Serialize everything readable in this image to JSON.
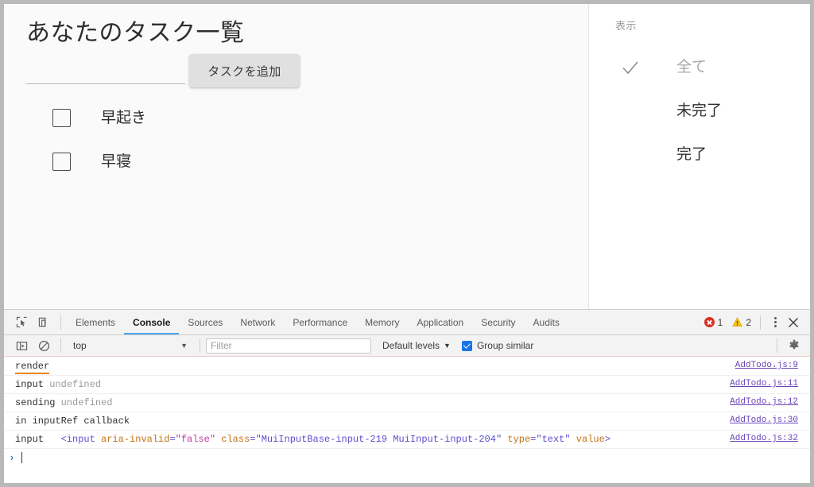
{
  "page": {
    "title": "あなたのタスク一覧",
    "input": {
      "value": "",
      "placeholder": ""
    },
    "add_button_label": "タスクを追加",
    "todos": [
      {
        "label": "早起き",
        "checked": false
      },
      {
        "label": "早寝",
        "checked": false
      }
    ],
    "filter_panel": {
      "heading": "表示",
      "items": [
        {
          "label": "全て",
          "selected": true
        },
        {
          "label": "未完了",
          "selected": false
        },
        {
          "label": "完了",
          "selected": false
        }
      ]
    }
  },
  "devtools": {
    "tabs": [
      {
        "label": "Elements",
        "active": false
      },
      {
        "label": "Console",
        "active": true
      },
      {
        "label": "Sources",
        "active": false
      },
      {
        "label": "Network",
        "active": false
      },
      {
        "label": "Performance",
        "active": false
      },
      {
        "label": "Memory",
        "active": false
      },
      {
        "label": "Application",
        "active": false
      },
      {
        "label": "Security",
        "active": false
      },
      {
        "label": "Audits",
        "active": false
      }
    ],
    "error_count": "1",
    "warning_count": "2",
    "filterbar": {
      "context": "top",
      "context_caret": "▼",
      "filter_placeholder": "Filter",
      "filter_value": "",
      "levels_label": "Default levels",
      "levels_caret": "▼",
      "group_similar_label": "Group similar",
      "group_similar_checked": true
    },
    "console_messages": [
      {
        "parts": [
          {
            "text": "render",
            "style": "plain-underline"
          }
        ],
        "source": "AddTodo.js:9"
      },
      {
        "parts": [
          {
            "text": "input ",
            "style": "plain"
          },
          {
            "text": "undefined",
            "style": "undef"
          }
        ],
        "source": "AddTodo.js:11"
      },
      {
        "parts": [
          {
            "text": "sending ",
            "style": "plain"
          },
          {
            "text": "undefined",
            "style": "undef"
          }
        ],
        "source": "AddTodo.js:12"
      },
      {
        "parts": [
          {
            "text": "in inputRef callback",
            "style": "plain"
          }
        ],
        "source": "AddTodo.js:30"
      },
      {
        "parts": [
          {
            "text": "input   ",
            "style": "plain"
          },
          {
            "text": "<input ",
            "style": "tag"
          },
          {
            "text": "aria-invalid",
            "style": "attr"
          },
          {
            "text": "=",
            "style": "tag"
          },
          {
            "text": "\"false\"",
            "style": "val"
          },
          {
            "text": " ",
            "style": "tag"
          },
          {
            "text": "class",
            "style": "attr"
          },
          {
            "text": "=",
            "style": "tag"
          },
          {
            "text": "\"MuiInputBase-input-219 MuiInput-input-204\"",
            "style": "val2"
          },
          {
            "text": " ",
            "style": "tag"
          },
          {
            "text": "type",
            "style": "attr"
          },
          {
            "text": "=",
            "style": "tag"
          },
          {
            "text": "\"text\"",
            "style": "val2"
          },
          {
            "text": " ",
            "style": "tag"
          },
          {
            "text": "value",
            "style": "attr"
          },
          {
            "text": ">",
            "style": "tag"
          }
        ],
        "source": "AddTodo.js:32"
      }
    ],
    "prompt_caret": "›"
  },
  "colors": {
    "accent_tab": "#4da6e8",
    "error_red": "#d93025",
    "warning_yellow": "#f5a623",
    "checkbox_blue": "#1a73e8",
    "source_link": "#6b45b8",
    "page_bg": "#fafafa"
  }
}
